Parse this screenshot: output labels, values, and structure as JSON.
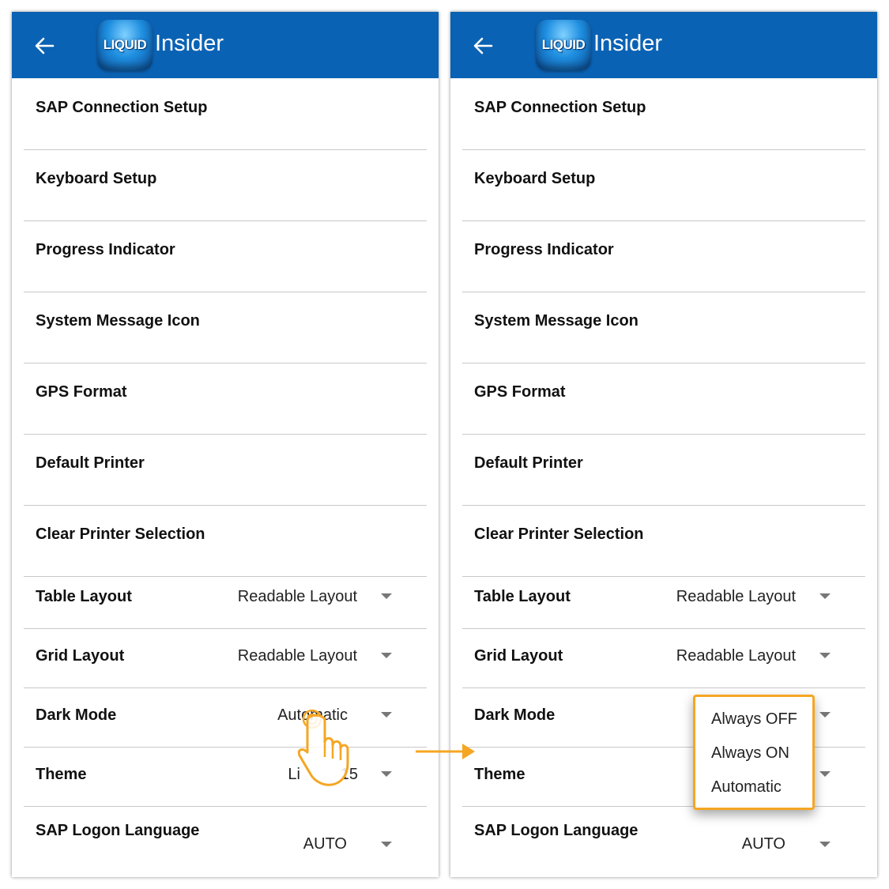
{
  "logo_text": "LIQUID",
  "app_title": "Insider",
  "accent_colors": {
    "header": "#0a62b4",
    "highlight": "#f5a623"
  },
  "menu_items": [
    "SAP Connection Setup",
    "Keyboard Setup",
    "Progress Indicator",
    "System Message Icon",
    "GPS Format",
    "Default Printer",
    "Clear Printer Selection"
  ],
  "settings": {
    "table_layout": {
      "label": "Table Layout",
      "value": "Readable Layout"
    },
    "grid_layout": {
      "label": "Grid Layout",
      "value": "Readable Layout"
    },
    "dark_mode": {
      "label": "Dark Mode",
      "value": "Automatic"
    },
    "theme": {
      "label": "Theme",
      "value_visible": "Li",
      "value_visible_end": "15"
    },
    "sap_logon_language": {
      "label": "SAP Logon Language",
      "value": "AUTO"
    }
  },
  "dark_mode_options": [
    "Always OFF",
    "Always ON",
    "Automatic"
  ],
  "icons": {
    "back": "arrow-left-icon",
    "dropdown": "caret-down-icon",
    "tap": "hand-tap-icon",
    "transition": "arrow-right-icon"
  }
}
